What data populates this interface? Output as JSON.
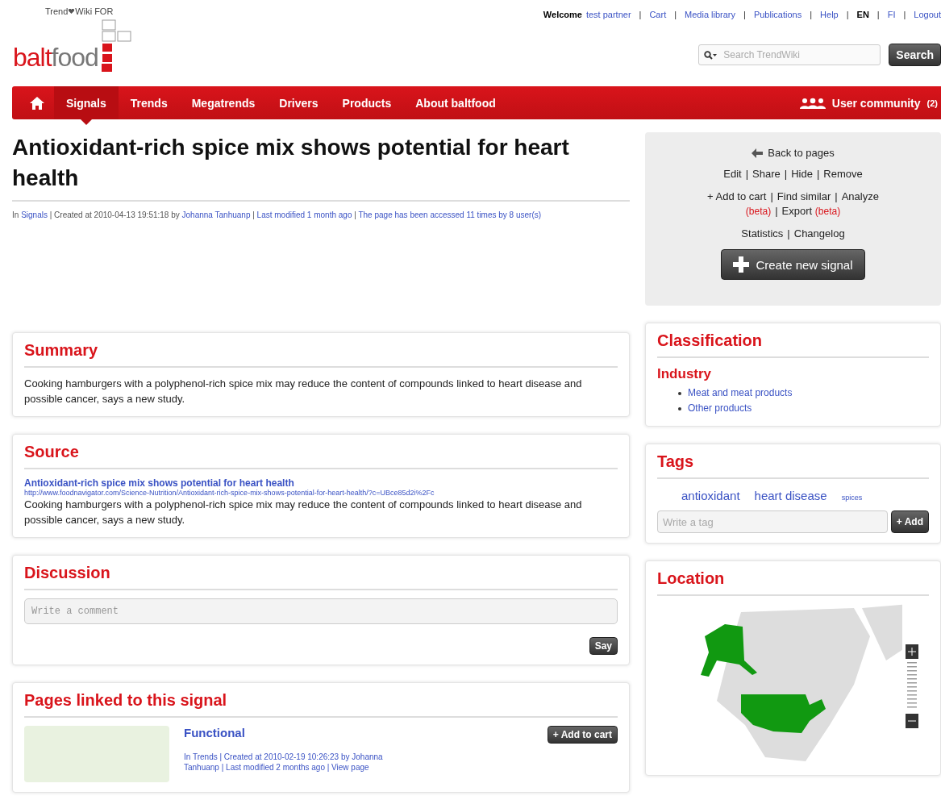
{
  "brand": {
    "tagline_1": "Trend",
    "tagline_2": "Wiki FOR",
    "logo_1": "balt",
    "logo_2": "food"
  },
  "top_bar": {
    "welcome": "Welcome",
    "user": "test partner",
    "links": [
      {
        "sep": "|",
        "label": "Cart",
        "selected": false
      },
      {
        "sep": "|",
        "label": "Media library",
        "selected": false
      },
      {
        "sep": "|",
        "label": "Publications",
        "selected": false
      },
      {
        "sep": "|",
        "label": "Help",
        "selected": false
      },
      {
        "sep": "|",
        "label": "EN",
        "selected": true
      },
      {
        "sep": "|",
        "label": "FI",
        "selected": false
      },
      {
        "sep": "|",
        "label": "Logout",
        "selected": false
      }
    ]
  },
  "search": {
    "placeholder": "Search TrendWiki",
    "button": "Search"
  },
  "nav": {
    "items": [
      {
        "label": "Signals",
        "selected": true
      },
      {
        "label": "Trends",
        "selected": false
      },
      {
        "label": "Megatrends",
        "selected": false
      },
      {
        "label": "Drivers",
        "selected": false
      },
      {
        "label": "Products",
        "selected": false
      },
      {
        "label": "About baltfood",
        "selected": false
      }
    ],
    "community": {
      "label": "User community",
      "count": "(2)"
    }
  },
  "article": {
    "title": "Antioxidant-rich spice mix shows potential for heart health",
    "meta": [
      {
        "kind": "text",
        "text": "In "
      },
      {
        "kind": "link",
        "text": "Signals"
      },
      {
        "kind": "text",
        "text": " | Created at 2010-04-13 19:51:18 by "
      },
      {
        "kind": "link",
        "text": "Johanna Tanhuanp"
      },
      {
        "kind": "text",
        "text": " | "
      },
      {
        "kind": "link",
        "text": "Last modified 1 month ago"
      },
      {
        "kind": "text",
        "text": " | "
      },
      {
        "kind": "link",
        "text": "The page has been accessed 11 times by 8 user(s)"
      }
    ]
  },
  "actions": {
    "back": "Back to pages",
    "edit_links": [
      {
        "label": "Edit"
      },
      {
        "sep": "|",
        "label": "Share"
      },
      {
        "sep": "|",
        "label": "Hide"
      },
      {
        "sep": "|",
        "label": "Remove"
      }
    ],
    "tool_links": [
      {
        "label": "+ Add to cart"
      },
      {
        "sep": "|",
        "label": "Find similar"
      },
      {
        "sep": "|",
        "label": "Analyze",
        "note": "(beta)"
      },
      {
        "sep": "|",
        "label": "Export",
        "note": "(beta)"
      }
    ],
    "info_links": [
      {
        "label": "Statistics"
      },
      {
        "sep": "|",
        "label": "Changelog"
      }
    ],
    "create": "Create new signal"
  },
  "summary": {
    "title": "Summary",
    "text": "Cooking hamburgers with a polyphenol-rich spice mix may reduce the content of compounds linked to heart disease and possible cancer, says a new study."
  },
  "source": {
    "title": "Source",
    "link": "Antioxidant-rich spice mix shows potential for heart health",
    "url": "http://www.foodnavigator.com/Science-Nutrition/Antioxidant-rich-spice-mix-shows-potential-for-heart-health/?c=UBce85d2i%2Fc",
    "text": "Cooking hamburgers with a polyphenol-rich spice mix may reduce the content of compounds linked to heart disease and possible cancer, says a new study."
  },
  "discussion": {
    "title": "Discussion",
    "placeholder": "Write a comment",
    "button": "Say"
  },
  "linked_pages": {
    "title": "Pages linked to this signal",
    "items": [
      {
        "title": "Functional",
        "button": "+ Add to cart",
        "meta_1": "In Trends | Created at 2010-02-19 10:26:23 by Johanna",
        "meta_2": "Tanhuanp | Last modified 2 months ago | View page"
      }
    ]
  },
  "classification": {
    "title": "Classification",
    "heading": "Industry",
    "items": [
      "Meat and meat products",
      "Other products"
    ]
  },
  "tags": {
    "title": "Tags",
    "items": [
      {
        "label": "antioxidant",
        "kind": "large"
      },
      {
        "label": "heart disease",
        "kind": "large"
      },
      {
        "label": "spices",
        "kind": "small"
      }
    ],
    "placeholder": "Write a tag",
    "button": "+ Add"
  },
  "location": {
    "title": "Location"
  }
}
